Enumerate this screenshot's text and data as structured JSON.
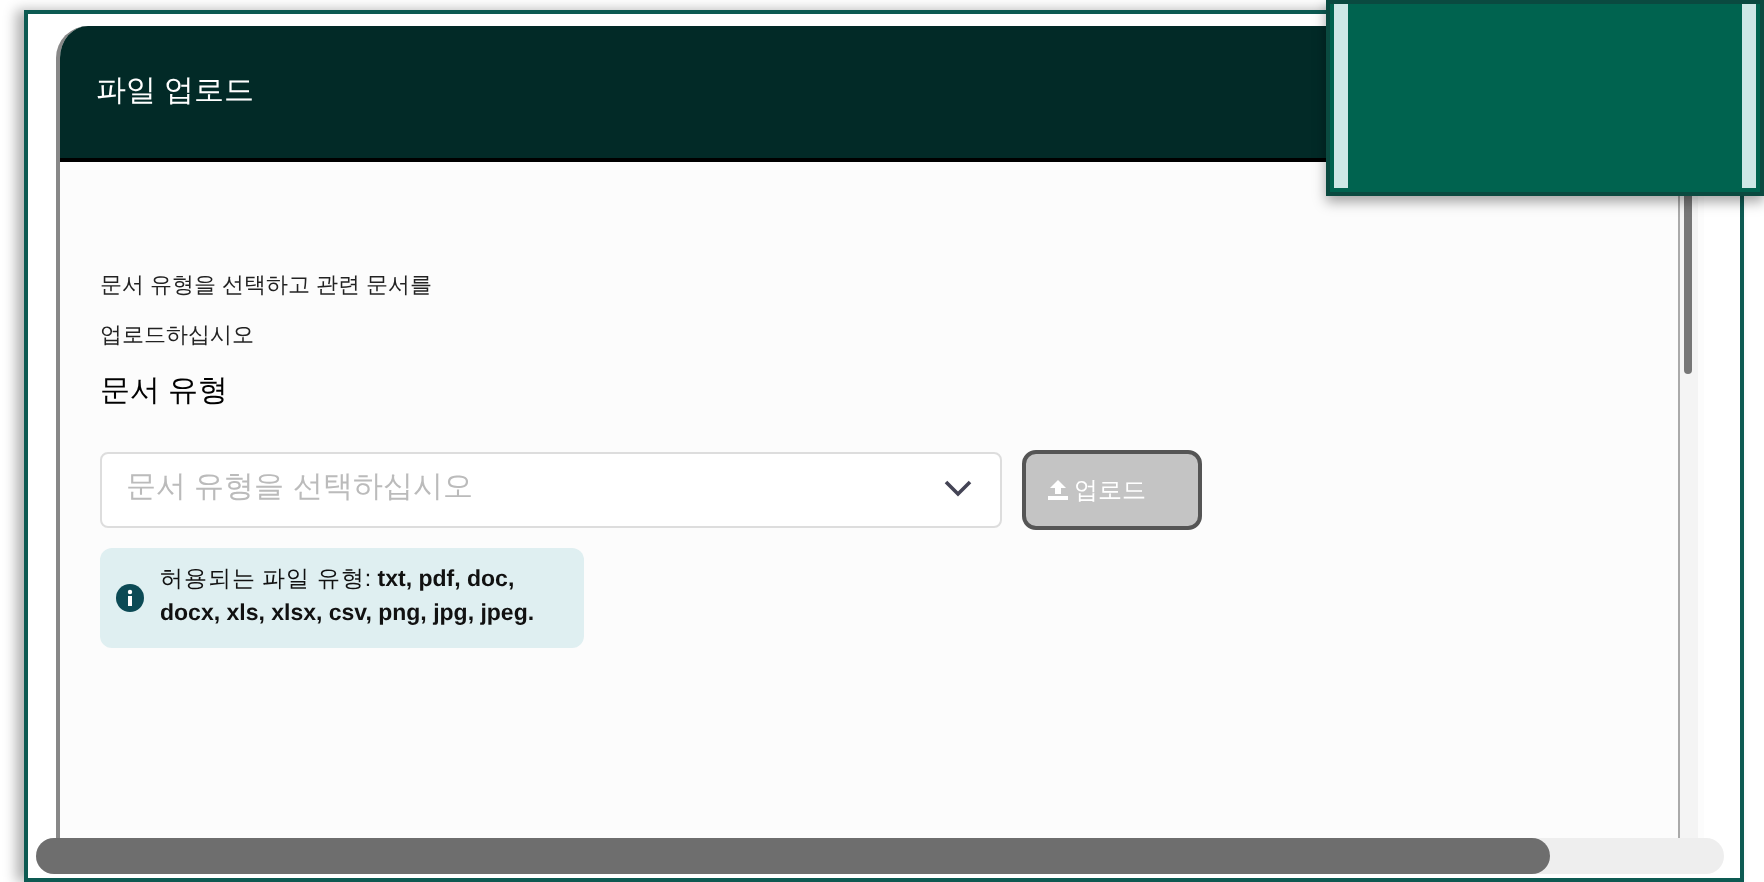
{
  "dialog": {
    "title": "파일 업로드"
  },
  "instructions": [
    "문서 유형을 선택하고 관련 문서를",
    "업로드하십시오"
  ],
  "document_type": {
    "label": "문서 유형",
    "placeholder": "문서 유형을 선택하십시오"
  },
  "upload_button": {
    "label": "업로드",
    "disabled": true
  },
  "info": {
    "text": "허용되는 파일 유형: **txt, pdf, doc, docx, xls, xlsx, csv, png, jpg, jpeg.**"
  }
}
